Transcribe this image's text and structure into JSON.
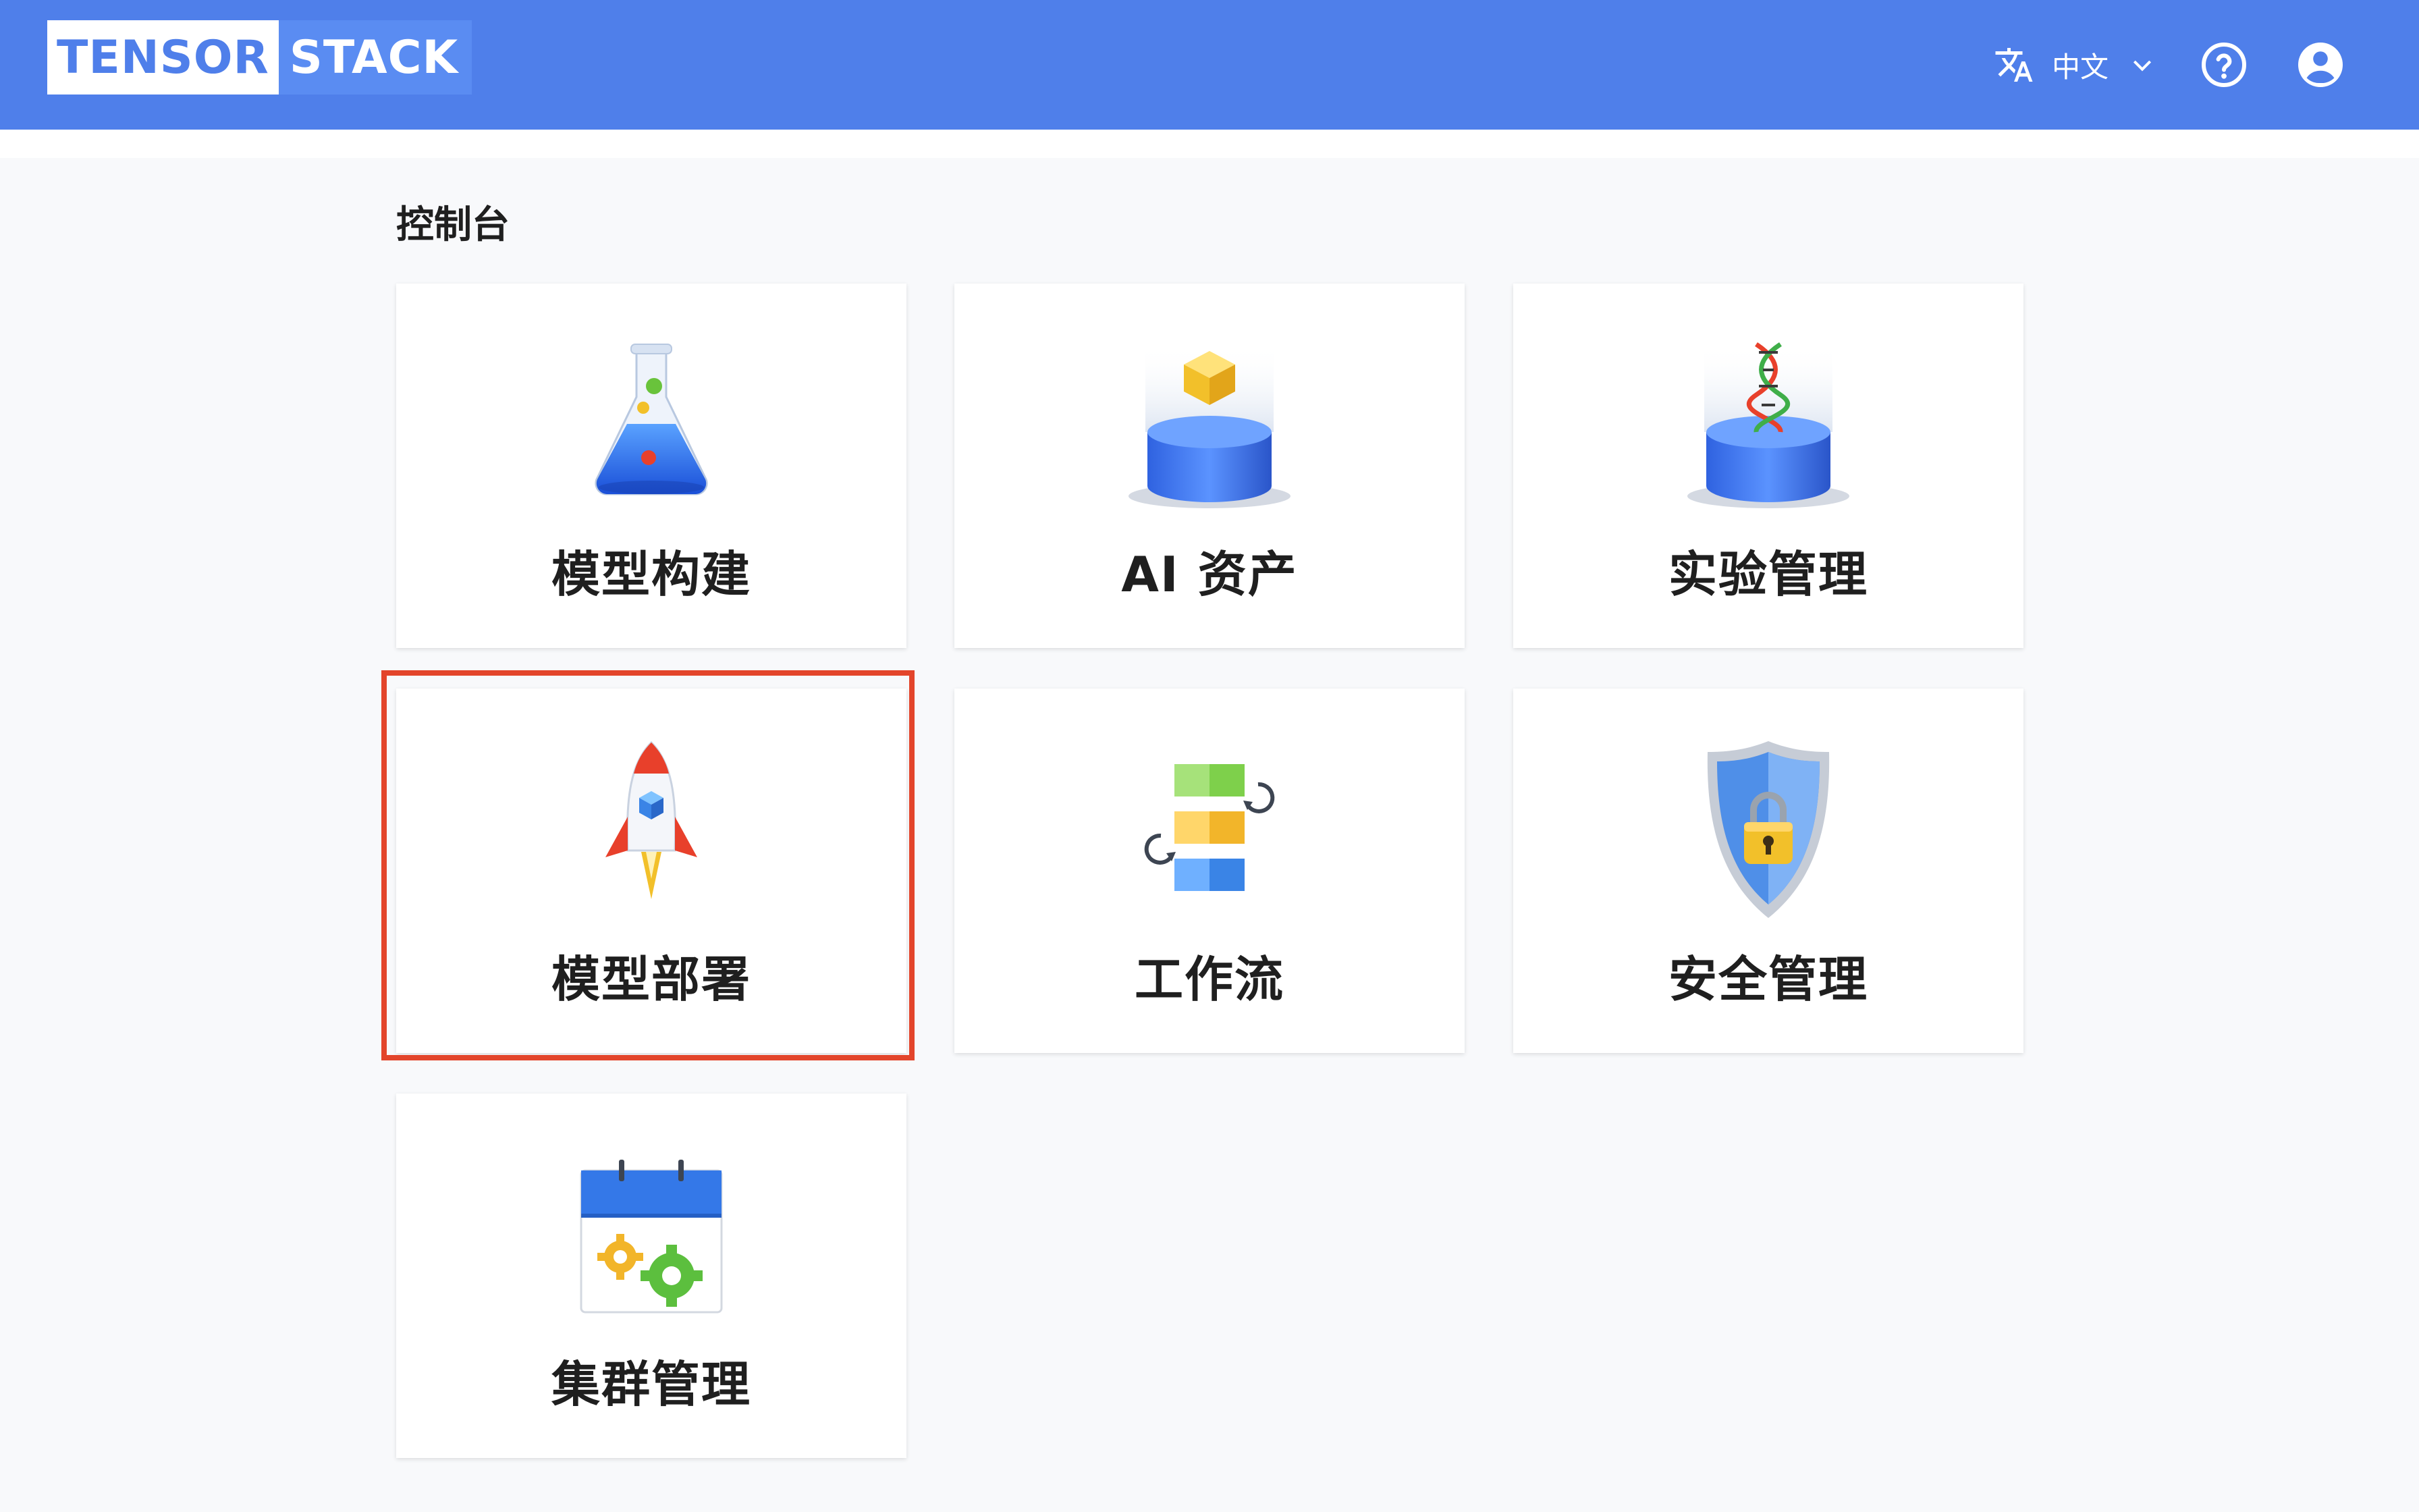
{
  "header": {
    "logo_part1": "TENSOR",
    "logo_part2": "STACK",
    "language_label": "中文",
    "icons": [
      "translate-icon",
      "chevron-down-icon",
      "help-icon",
      "account-icon"
    ],
    "colors": {
      "header_bg": "#4f7fea",
      "highlight_border": "#e3452b"
    }
  },
  "page": {
    "title": "控制台"
  },
  "cards": [
    {
      "label": "模型构建",
      "icon": "flask-icon"
    },
    {
      "label": "AI 资产",
      "icon": "cube-on-cylinder-icon"
    },
    {
      "label": "实验管理",
      "icon": "dna-on-cylinder-icon"
    },
    {
      "label": "模型部署",
      "icon": "rocket-icon",
      "highlighted": true
    },
    {
      "label": "工作流",
      "icon": "workflow-blocks-icon"
    },
    {
      "label": "安全管理",
      "icon": "shield-lock-icon"
    },
    {
      "label": "集群管理",
      "icon": "calendar-gears-icon"
    }
  ]
}
